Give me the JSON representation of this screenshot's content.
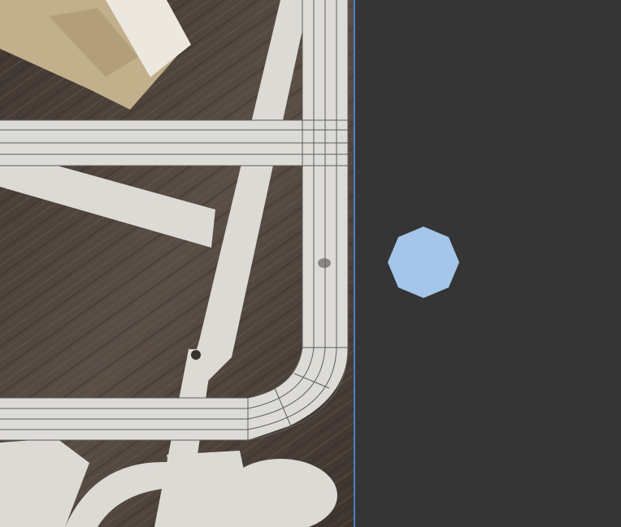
{
  "viewport": {
    "background_image": "kitbash-part-reference-photo",
    "overlay": "mesh-wireframe"
  },
  "colors": {
    "panel_background": "#353535",
    "divider": "#4d7fc8",
    "handle_fill": "#a5c6ea",
    "mesh_line": "#5c5c5c",
    "part_plastic": "#dcdad5",
    "table_wood": "#4a4038"
  },
  "side_panel": {
    "handle_icon": "octagon-handle-icon"
  }
}
